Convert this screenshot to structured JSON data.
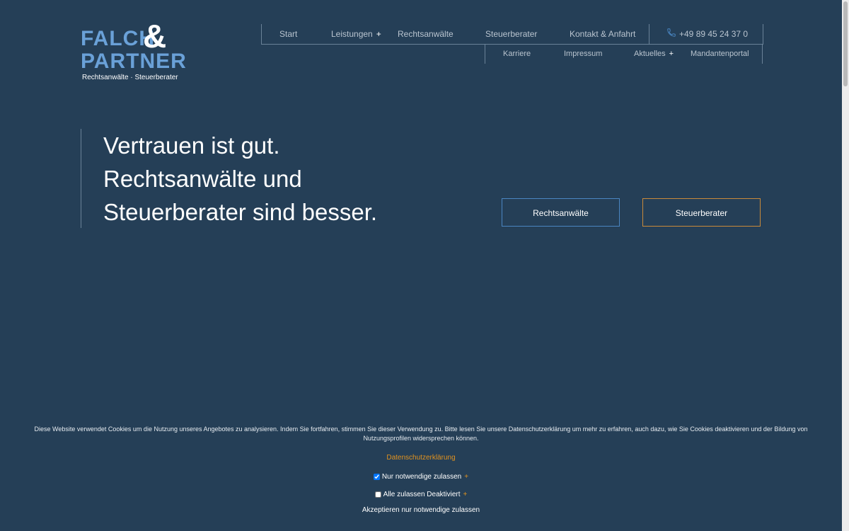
{
  "logo": {
    "line1": "FALCH",
    "amp": "&",
    "line2": "PARTNER",
    "tagline": "Rechtsanwälte · Steuerberater"
  },
  "nav": {
    "main": [
      {
        "label": "Start"
      },
      {
        "label": "Leistungen",
        "has_submenu": true
      },
      {
        "label": "Rechtsanwälte"
      },
      {
        "label": "Steuerberater"
      },
      {
        "label": "Kontakt & Anfahrt"
      }
    ],
    "phone": "+49 89 45 24 37 0",
    "sub": [
      {
        "label": "Karriere"
      },
      {
        "label": "Impressum"
      },
      {
        "label": "Aktuelles",
        "has_submenu": true
      },
      {
        "label": "Mandantenportal"
      }
    ],
    "plus_symbol": "+"
  },
  "hero": {
    "lines": [
      "Vertrauen ist gut.",
      "Rechtsanwälte und",
      "Steuerberater sind besser."
    ],
    "buttons": {
      "lawyers": "Rechtsanwälte",
      "tax": "Steuerberater"
    }
  },
  "cookie": {
    "text": "Diese Website verwendet Cookies um die Nutzung unseres Angebotes zu analysieren. Indem Sie fortfahren, stimmen Sie dieser Verwendung zu. Bitte lesen Sie unsere Datenschutzerklärung um mehr zu erfahren, auch dazu, wie Sie Cookies deaktivieren und der Bildung von Nutzungsprofilen widersprechen können.",
    "privacy_link": "Datenschutzerklärung",
    "option_necessary": "Nur notwendige zulassen",
    "option_necessary_checked": true,
    "option_all": "Alle zulassen Deaktiviert",
    "option_all_checked": false,
    "plus": "+",
    "accept": "Akzeptieren nur notwendige zulassen"
  },
  "colors": {
    "background": "#253f57",
    "accent_blue": "#4a86c2",
    "accent_orange": "#c98a3a",
    "link_orange": "#e0921f"
  }
}
